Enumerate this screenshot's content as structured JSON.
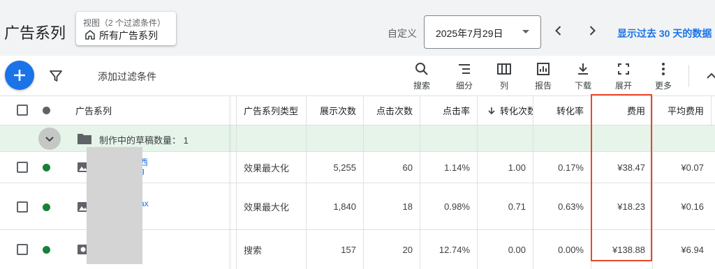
{
  "header": {
    "title": "广告系列",
    "view_caption": "视图（2 个过滤条件）",
    "view_value": "所有广告系列",
    "date_label": "自定义",
    "date_value": "2025年7月29日",
    "range_link": "显示过去 30 天的数据"
  },
  "toolbar": {
    "filter_label": "添加过滤条件",
    "tools": {
      "search": "搜索",
      "segment": "细分",
      "columns": "列",
      "reports": "报告",
      "download": "下载",
      "expand": "展开",
      "more": "更多"
    }
  },
  "table": {
    "columns": {
      "campaign": "广告系列",
      "type": "广告系列类型",
      "impressions": "展示次数",
      "clicks": "点击次数",
      "ctr": "点击率",
      "conversions": "转化次数",
      "conv_rate": "转化率",
      "cost": "费用",
      "avg_cost": "平均费用"
    },
    "group_label": "制作中的草稿数量：  1",
    "rows": [
      {
        "link_fragment_1": "西",
        "link_fragment_2": "g",
        "type": "效果最大化",
        "impressions": "5,255",
        "clicks": "60",
        "ctr": "1.14%",
        "conversions": "1.00",
        "conv_rate": "0.17%",
        "cost": "¥38.47",
        "avg_cost": "¥0.07"
      },
      {
        "link_fragment_1": "ax",
        "link_fragment_2": "",
        "type": "效果最大化",
        "impressions": "1,840",
        "clicks": "18",
        "ctr": "0.98%",
        "conversions": "0.71",
        "conv_rate": "0.63%",
        "cost": "¥18.23",
        "avg_cost": "¥0.16"
      },
      {
        "link_fragment_1": "",
        "link_fragment_2": "",
        "type": "搜索",
        "impressions": "157",
        "clicks": "20",
        "ctr": "12.74%",
        "conversions": "0.00",
        "conv_rate": "0.00%",
        "cost": "¥138.88",
        "avg_cost": "¥6.94"
      }
    ]
  },
  "colors": {
    "accent": "#1a73e8",
    "status_enabled": "#188038",
    "group_bg": "#e6f4ea",
    "highlight": "#e8472b"
  },
  "icons": [
    "home-icon",
    "chevron-left-icon",
    "chevron-right-icon",
    "plus-icon",
    "filter-icon",
    "search-icon",
    "segment-icon",
    "columns-icon",
    "reports-icon",
    "download-icon",
    "expand-icon",
    "more-icon",
    "collapse-icon",
    "folder-icon",
    "image-icon",
    "arrow-down-icon"
  ]
}
